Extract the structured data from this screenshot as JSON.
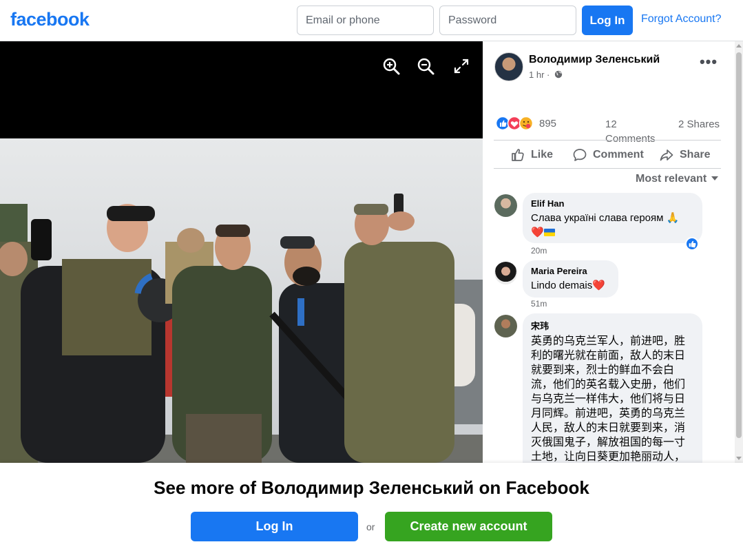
{
  "header": {
    "logo": "facebook",
    "email_placeholder": "Email or phone",
    "password_placeholder": "Password",
    "login_label": "Log In",
    "forgot_label": "Forgot Account?"
  },
  "viewer": {
    "icons": [
      "zoom-in-icon",
      "zoom-out-icon",
      "fullscreen-icon"
    ]
  },
  "post": {
    "author": "Володимир Зеленський",
    "time": "1 hr ·",
    "reaction_count": "895",
    "comments_count": "12 Comments",
    "shares_count": "2 Shares",
    "actions": {
      "like": "Like",
      "comment": "Comment",
      "share": "Share"
    },
    "sort_label": "Most relevant"
  },
  "comments": [
    {
      "name": "Elif Han",
      "text": "Слава україні слава героям 🙏",
      "time": "20m"
    },
    {
      "name": "Maria Pereira",
      "text": "Lindo demais",
      "time": "51m"
    },
    {
      "name": "宋玮",
      "text": "英勇的乌克兰军人，前进吧，胜利的曙光就在前面，敌人的末日就要到来，烈士的鲜血不会白流，他们的英名载入史册，他们与乌克兰一样伟大，他们将与日月同辉。前进吧，英勇的乌克兰人民，敌人的末日就要到来，消灭俄国鬼子，解放祖国的每一寸土地，让向日葵更加艳丽动人，"
    }
  ],
  "cta": {
    "title": "See more of Володимир Зеленський on Facebook",
    "login_label": "Log In",
    "or_label": "or",
    "create_label": "Create new account"
  },
  "colors": {
    "brand": "#1877f2",
    "create_green": "#36a420",
    "muted_text": "#65676b"
  }
}
